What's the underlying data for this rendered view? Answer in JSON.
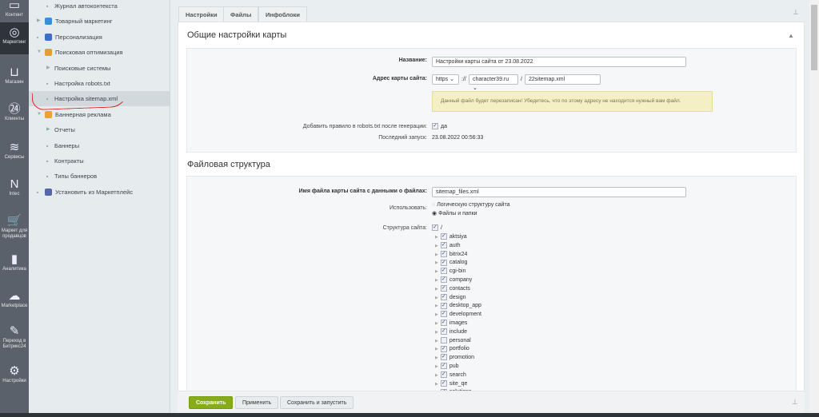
{
  "iconbar": [
    {
      "label": "Контент",
      "icon": "content-icon",
      "glyph": "▭"
    },
    {
      "label": "Маркетинг",
      "icon": "target-icon",
      "glyph": "◎",
      "active": true
    },
    {
      "label": "Магазин",
      "icon": "basket-icon",
      "glyph": "⊔"
    },
    {
      "label": "Клиенты",
      "icon": "clients-24-icon",
      "glyph": "㉔"
    },
    {
      "label": "Сервисы",
      "icon": "layers-icon",
      "glyph": "≋"
    },
    {
      "label": "Intec",
      "icon": "intec-logo-icon",
      "glyph": "N"
    },
    {
      "label": "Маркет для продавцов",
      "icon": "cart-icon",
      "glyph": "🛒"
    },
    {
      "label": "Аналитика",
      "icon": "bar-chart-icon",
      "glyph": "▮"
    },
    {
      "label": "Marketplace",
      "icon": "cloud-download-icon",
      "glyph": "☁"
    },
    {
      "label": "Переход в Битрикс24",
      "icon": "edit-wand-icon",
      "glyph": "✎"
    },
    {
      "label": "Настройки",
      "icon": "gear-icon",
      "glyph": "⚙"
    }
  ],
  "menu": [
    {
      "label": "Журнал автоконтекста",
      "level": 2,
      "marker": "dot"
    },
    {
      "label": "Товарный маркетинг",
      "level": 1,
      "marker": "arrow",
      "icon": "percent-icon",
      "color": "#3a8ed8"
    },
    {
      "label": "Персонализация",
      "level": 1,
      "marker": "dot",
      "icon": "personalization-icon",
      "color": "#3b6fc9"
    },
    {
      "label": "Поисковая оптимизация",
      "level": 1,
      "marker": "open",
      "icon": "seo-icon",
      "color": "#e0a030"
    },
    {
      "label": "Поисковые системы",
      "level": 2,
      "marker": "arrow"
    },
    {
      "label": "Настройка robots.txt",
      "level": 2,
      "marker": "dot"
    },
    {
      "label": "Настройка sitemap.xml",
      "level": 2,
      "marker": "dot",
      "selected": true
    },
    {
      "label": "Баннерная реклама",
      "level": 1,
      "marker": "open",
      "icon": "banner-icon",
      "color": "#f0a030"
    },
    {
      "label": "Отчеты",
      "level": 2,
      "marker": "arrow"
    },
    {
      "label": "Баннеры",
      "level": 2,
      "marker": "dot"
    },
    {
      "label": "Контракты",
      "level": 2,
      "marker": "dot"
    },
    {
      "label": "Типы баннеров",
      "level": 2,
      "marker": "dot"
    },
    {
      "label": "Установить из Маркетплейс",
      "level": 1,
      "marker": "dot",
      "icon": "cart-icon",
      "color": "#56a"
    }
  ],
  "tabs": [
    "Настройки",
    "Файлы",
    "Инфоблоки"
  ],
  "general": {
    "title": "Общие настройки карты",
    "name_label": "Название:",
    "name_value": "Настройки карты сайта от 23.08.2022",
    "address_label": "Адрес карты сайта:",
    "protocol": "https",
    "sep1": "://",
    "domain": "character39.ru",
    "sep2": "/",
    "filename": "22sitemap.xml",
    "warning": "Данный файл будет перезаписан! Убедитесь, что по этому адресу не находится нужный вам файл.",
    "robots_label": "Добавить правило в robots.txt после генерации:",
    "robots_value": "да",
    "last_run_label": "Последний запуск:",
    "last_run_value": "23.08.2022 00:56:33"
  },
  "files": {
    "title": "Файловая структура",
    "file_label": "Имя файла карты сайта с данными о файлах:",
    "file_value": "sitemap_files.xml",
    "use_label": "Использовать:",
    "use_options": [
      {
        "label": "Логическую структуру сайта",
        "checked": false
      },
      {
        "label": "Файлы и папки",
        "checked": true
      }
    ],
    "structure_label": "Структура сайта:",
    "root": "/",
    "tree": [
      {
        "name": "aktsiya",
        "checked": true
      },
      {
        "name": "auth",
        "checked": true
      },
      {
        "name": "bitrix24",
        "checked": true
      },
      {
        "name": "catalog",
        "checked": true
      },
      {
        "name": "cgi-bin",
        "checked": true
      },
      {
        "name": "company",
        "checked": true
      },
      {
        "name": "contacts",
        "checked": true
      },
      {
        "name": "design",
        "checked": true
      },
      {
        "name": "desktop_app",
        "checked": true
      },
      {
        "name": "development",
        "checked": true
      },
      {
        "name": "images",
        "checked": true
      },
      {
        "name": "include",
        "checked": true
      },
      {
        "name": "personal",
        "checked": false
      },
      {
        "name": "portfolio",
        "checked": true
      },
      {
        "name": "promotion",
        "checked": true
      },
      {
        "name": "pub",
        "checked": true
      },
      {
        "name": "search",
        "checked": true
      },
      {
        "name": "site_qe",
        "checked": true
      },
      {
        "name": "solutions",
        "checked": true
      }
    ]
  },
  "footer": {
    "save": "Сохранить",
    "apply": "Применить",
    "save_run": "Сохранить и запустить"
  },
  "colors": {
    "accent": "#86ad19",
    "iconbar": "#5a616b",
    "annotation": "#dd2222"
  }
}
